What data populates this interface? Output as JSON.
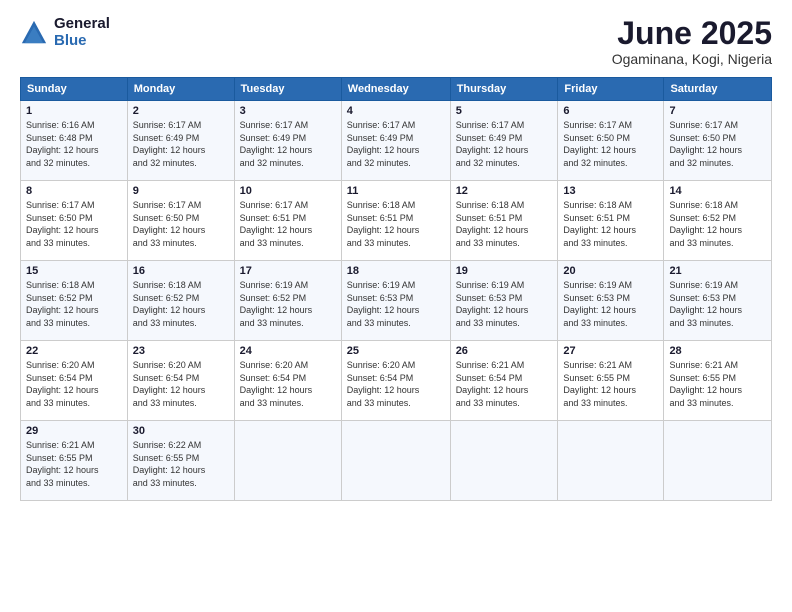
{
  "logo": {
    "general": "General",
    "blue": "Blue"
  },
  "title": "June 2025",
  "subtitle": "Ogaminana, Kogi, Nigeria",
  "headers": [
    "Sunday",
    "Monday",
    "Tuesday",
    "Wednesday",
    "Thursday",
    "Friday",
    "Saturday"
  ],
  "weeks": [
    [
      {
        "day": "1",
        "sunrise": "6:16 AM",
        "sunset": "6:48 PM",
        "daylight": "12 hours and 32 minutes."
      },
      {
        "day": "2",
        "sunrise": "6:17 AM",
        "sunset": "6:49 PM",
        "daylight": "12 hours and 32 minutes."
      },
      {
        "day": "3",
        "sunrise": "6:17 AM",
        "sunset": "6:49 PM",
        "daylight": "12 hours and 32 minutes."
      },
      {
        "day": "4",
        "sunrise": "6:17 AM",
        "sunset": "6:49 PM",
        "daylight": "12 hours and 32 minutes."
      },
      {
        "day": "5",
        "sunrise": "6:17 AM",
        "sunset": "6:49 PM",
        "daylight": "12 hours and 32 minutes."
      },
      {
        "day": "6",
        "sunrise": "6:17 AM",
        "sunset": "6:50 PM",
        "daylight": "12 hours and 32 minutes."
      },
      {
        "day": "7",
        "sunrise": "6:17 AM",
        "sunset": "6:50 PM",
        "daylight": "12 hours and 32 minutes."
      }
    ],
    [
      {
        "day": "8",
        "sunrise": "6:17 AM",
        "sunset": "6:50 PM",
        "daylight": "12 hours and 33 minutes."
      },
      {
        "day": "9",
        "sunrise": "6:17 AM",
        "sunset": "6:50 PM",
        "daylight": "12 hours and 33 minutes."
      },
      {
        "day": "10",
        "sunrise": "6:17 AM",
        "sunset": "6:51 PM",
        "daylight": "12 hours and 33 minutes."
      },
      {
        "day": "11",
        "sunrise": "6:18 AM",
        "sunset": "6:51 PM",
        "daylight": "12 hours and 33 minutes."
      },
      {
        "day": "12",
        "sunrise": "6:18 AM",
        "sunset": "6:51 PM",
        "daylight": "12 hours and 33 minutes."
      },
      {
        "day": "13",
        "sunrise": "6:18 AM",
        "sunset": "6:51 PM",
        "daylight": "12 hours and 33 minutes."
      },
      {
        "day": "14",
        "sunrise": "6:18 AM",
        "sunset": "6:52 PM",
        "daylight": "12 hours and 33 minutes."
      }
    ],
    [
      {
        "day": "15",
        "sunrise": "6:18 AM",
        "sunset": "6:52 PM",
        "daylight": "12 hours and 33 minutes."
      },
      {
        "day": "16",
        "sunrise": "6:18 AM",
        "sunset": "6:52 PM",
        "daylight": "12 hours and 33 minutes."
      },
      {
        "day": "17",
        "sunrise": "6:19 AM",
        "sunset": "6:52 PM",
        "daylight": "12 hours and 33 minutes."
      },
      {
        "day": "18",
        "sunrise": "6:19 AM",
        "sunset": "6:53 PM",
        "daylight": "12 hours and 33 minutes."
      },
      {
        "day": "19",
        "sunrise": "6:19 AM",
        "sunset": "6:53 PM",
        "daylight": "12 hours and 33 minutes."
      },
      {
        "day": "20",
        "sunrise": "6:19 AM",
        "sunset": "6:53 PM",
        "daylight": "12 hours and 33 minutes."
      },
      {
        "day": "21",
        "sunrise": "6:19 AM",
        "sunset": "6:53 PM",
        "daylight": "12 hours and 33 minutes."
      }
    ],
    [
      {
        "day": "22",
        "sunrise": "6:20 AM",
        "sunset": "6:54 PM",
        "daylight": "12 hours and 33 minutes."
      },
      {
        "day": "23",
        "sunrise": "6:20 AM",
        "sunset": "6:54 PM",
        "daylight": "12 hours and 33 minutes."
      },
      {
        "day": "24",
        "sunrise": "6:20 AM",
        "sunset": "6:54 PM",
        "daylight": "12 hours and 33 minutes."
      },
      {
        "day": "25",
        "sunrise": "6:20 AM",
        "sunset": "6:54 PM",
        "daylight": "12 hours and 33 minutes."
      },
      {
        "day": "26",
        "sunrise": "6:21 AM",
        "sunset": "6:54 PM",
        "daylight": "12 hours and 33 minutes."
      },
      {
        "day": "27",
        "sunrise": "6:21 AM",
        "sunset": "6:55 PM",
        "daylight": "12 hours and 33 minutes."
      },
      {
        "day": "28",
        "sunrise": "6:21 AM",
        "sunset": "6:55 PM",
        "daylight": "12 hours and 33 minutes."
      }
    ],
    [
      {
        "day": "29",
        "sunrise": "6:21 AM",
        "sunset": "6:55 PM",
        "daylight": "12 hours and 33 minutes."
      },
      {
        "day": "30",
        "sunrise": "6:22 AM",
        "sunset": "6:55 PM",
        "daylight": "12 hours and 33 minutes."
      },
      null,
      null,
      null,
      null,
      null
    ]
  ],
  "labels": {
    "sunrise": "Sunrise:",
    "sunset": "Sunset:",
    "daylight": "Daylight:"
  }
}
